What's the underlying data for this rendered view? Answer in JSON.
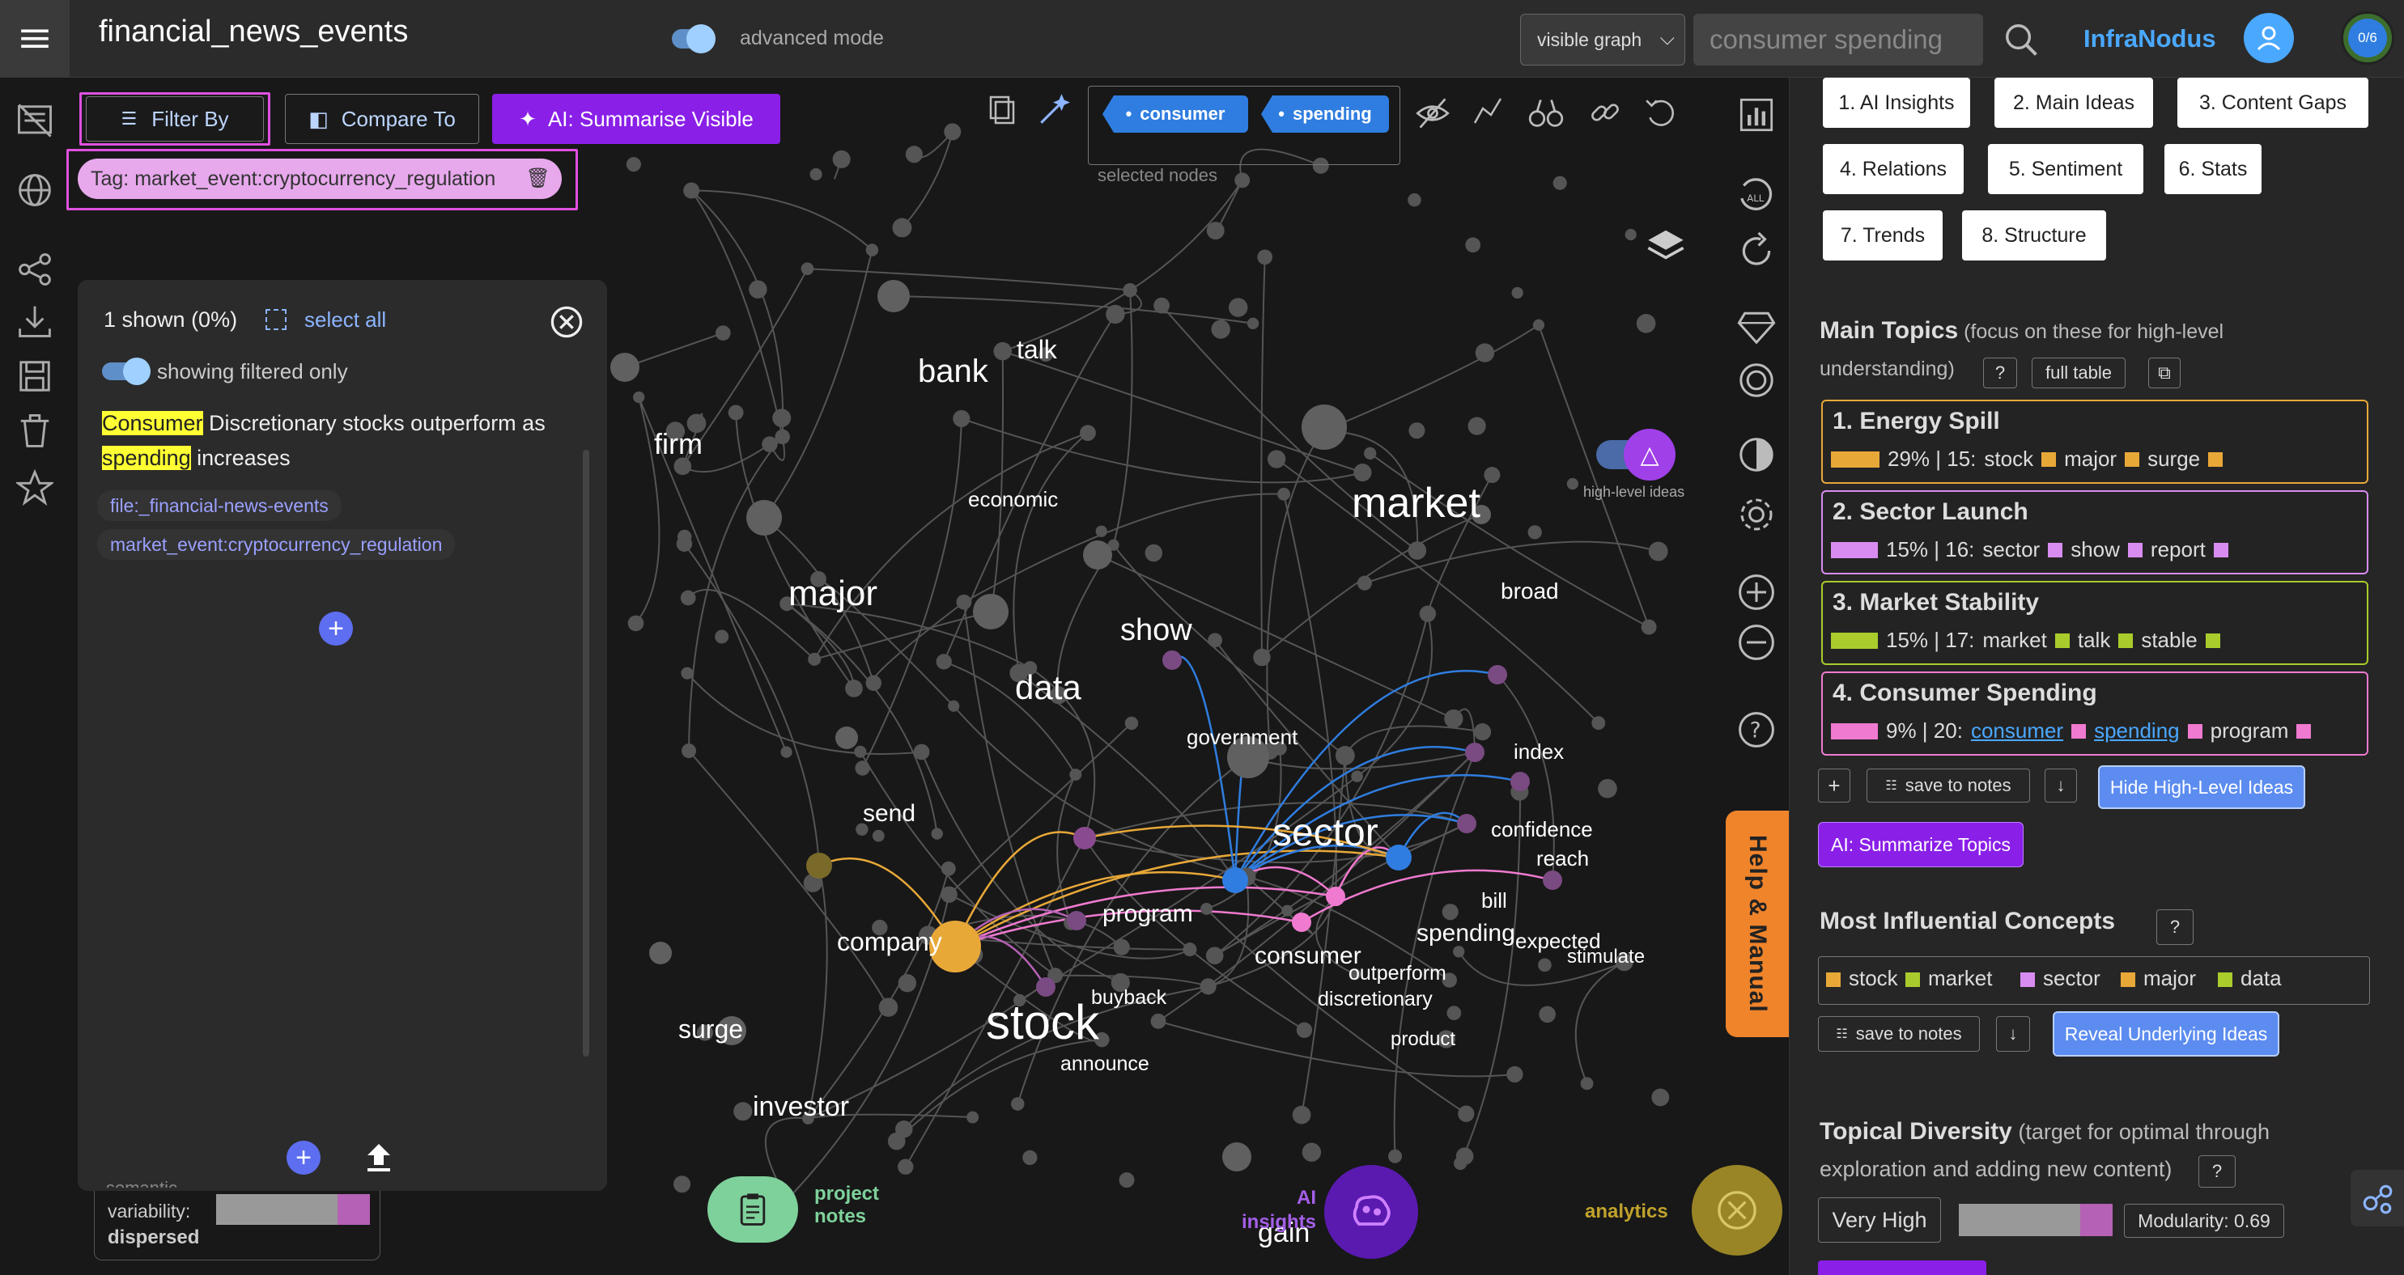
{
  "header": {
    "title": "financial_news_events",
    "advanced_mode_label": "advanced mode",
    "view_select": "visible graph",
    "search_value": "consumer spending",
    "brand": "InfraNodus",
    "counter": "0/6"
  },
  "toolbar": {
    "filter_by": "Filter By",
    "compare_to": "Compare To",
    "summarise": "AI: Summarise Visible",
    "tag_filter": "Tag: market_event:cryptocurrency_regulation",
    "selected_nodes_label": "selected nodes",
    "selected_nodes": [
      "consumer",
      "spending"
    ]
  },
  "statements_panel": {
    "shown": "1 shown (0%)",
    "select_all": "select all",
    "filtered_only": "showing filtered only",
    "statement": {
      "hl1": "Consumer",
      "part1": " Discretionary stocks outperform as ",
      "hl2": "spending",
      "part2": " increases"
    },
    "tags": [
      "file:_financial-news-events",
      "market_event:cryptocurrency_regulation"
    ]
  },
  "variability": {
    "line1": "semantic",
    "line2": "variability:",
    "value": "dispersed"
  },
  "graph": {
    "nodes": [
      {
        "label": "bank"
      },
      {
        "label": "talk"
      },
      {
        "label": "firm"
      },
      {
        "label": "economic"
      },
      {
        "label": "market"
      },
      {
        "label": "major"
      },
      {
        "label": "show"
      },
      {
        "label": "broad"
      },
      {
        "label": "data"
      },
      {
        "label": "government"
      },
      {
        "label": "index"
      },
      {
        "label": "send"
      },
      {
        "label": "sector"
      },
      {
        "label": "confidence"
      },
      {
        "label": "reach"
      },
      {
        "label": "bill"
      },
      {
        "label": "program"
      },
      {
        "label": "spending"
      },
      {
        "label": "expected"
      },
      {
        "label": "company"
      },
      {
        "label": "consumer"
      },
      {
        "label": "stimulate"
      },
      {
        "label": "outperform"
      },
      {
        "label": "buyback"
      },
      {
        "label": "discretionary"
      },
      {
        "label": "stock"
      },
      {
        "label": "surge"
      },
      {
        "label": "product"
      },
      {
        "label": "announce"
      },
      {
        "label": "investor"
      },
      {
        "label": "gain"
      }
    ],
    "high_level_ideas": "high-level ideas",
    "help_manual": "Help & Manual",
    "project_notes": "project notes",
    "ai_insights": "AI insights",
    "analytics": "analytics"
  },
  "right_panel": {
    "tabs": [
      "1. AI Insights",
      "2. Main Ideas",
      "3. Content Gaps",
      "4. Relations",
      "5. Sentiment",
      "6. Stats",
      "7. Trends",
      "8. Structure"
    ],
    "main_topics_title": "Main Topics",
    "main_topics_desc1": " (focus on these for high-level",
    "main_topics_desc2": "understanding)",
    "question": "?",
    "full_table": "full table",
    "topics": [
      {
        "title": "1. Energy Spill",
        "pct": "29% | 15:",
        "words": [
          "stock",
          "major",
          "surge"
        ],
        "color": "#e8a838"
      },
      {
        "title": "2. Sector Launch",
        "pct": "15% | 16:",
        "words": [
          "sector",
          "show",
          "report"
        ],
        "color": "#d98cf0"
      },
      {
        "title": "3. Market Stability",
        "pct": "15% | 17:",
        "words": [
          "market",
          "talk",
          "stable"
        ],
        "color": "#a9cc2c"
      },
      {
        "title": "4. Consumer Spending",
        "pct": "9% | 20:",
        "words": [
          "consumer",
          "spending",
          "program"
        ],
        "color": "#f07ad0"
      }
    ],
    "plus": "+",
    "save_to_notes": "save to notes",
    "down_arrow": "↓",
    "hide_ideas": "Hide High-Level Ideas",
    "summarize_topics": "AI: Summarize Topics",
    "influential_title": "Most Influential Concepts",
    "influential": [
      {
        "word": "stock",
        "color": "#e8a838"
      },
      {
        "word": "market",
        "color": "#a9cc2c"
      },
      {
        "word": "sector",
        "color": "#d98cf0"
      },
      {
        "word": "major",
        "color": "#e8a838"
      },
      {
        "word": "data",
        "color": "#a9cc2c"
      }
    ],
    "reveal_ideas": "Reveal Underlying Ideas",
    "diversity_title": "Topical Diversity",
    "diversity_desc1": " (target for optimal through",
    "diversity_desc2": "exploration and adding new content)",
    "diversity_value": "Very High",
    "modularity": "Modularity: 0.69"
  },
  "colors": {
    "accent_purple": "#8a2be2",
    "highlight_yellow": "#ffff33",
    "selected_blue": "#2f7de0",
    "help_orange": "#f0842b"
  }
}
